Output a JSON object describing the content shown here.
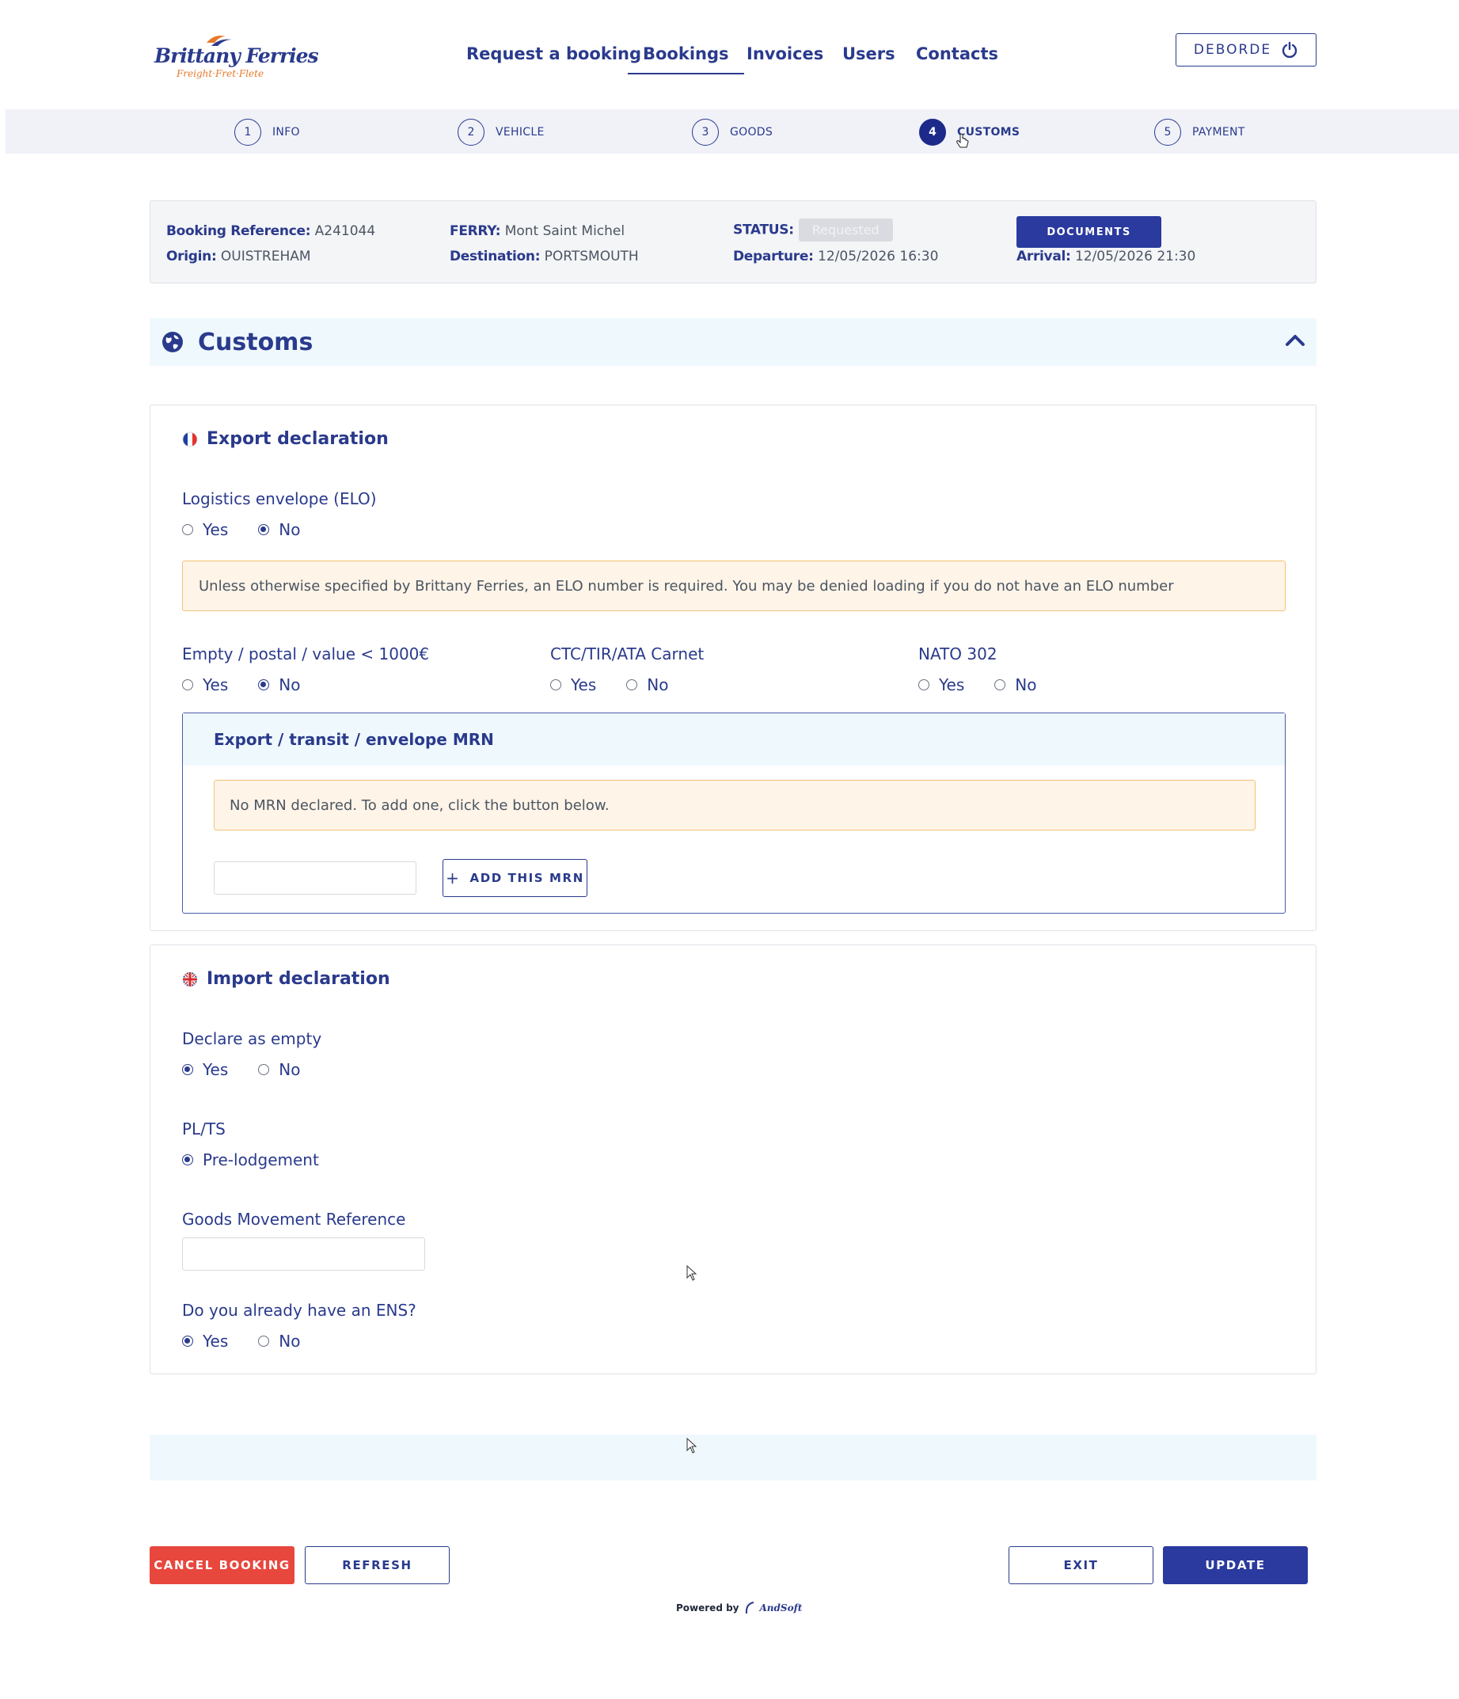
{
  "header": {
    "logo_main": "Brittany Ferries",
    "logo_sub": "Freight·Fret·Flete",
    "nav": [
      {
        "label": "Request a booking"
      },
      {
        "label": "Bookings"
      },
      {
        "label": "Invoices"
      },
      {
        "label": "Users"
      },
      {
        "label": "Contacts"
      }
    ],
    "active_nav": "Bookings",
    "user_label": "DEBORDE"
  },
  "stepper": {
    "steps": [
      {
        "number": "1",
        "label": "INFO"
      },
      {
        "number": "2",
        "label": "VEHICLE"
      },
      {
        "number": "3",
        "label": "GOODS"
      },
      {
        "number": "4",
        "label": "CUSTOMS"
      },
      {
        "number": "5",
        "label": "PAYMENT"
      }
    ],
    "active_step": "4"
  },
  "booking": {
    "reference_label": "Booking Reference:",
    "reference": "A241044",
    "origin_label": "Origin:",
    "origin": "OUISTREHAM",
    "ferry_label": "FERRY:",
    "ferry": "Mont Saint Michel",
    "destination_label": "Destination:",
    "destination": "PORTSMOUTH",
    "status_label": "STATUS:",
    "status": "Requested",
    "departure_label": "Departure:",
    "departure": "12/05/2026 16:30",
    "arrival_label": "Arrival:",
    "arrival": "12/05/2026 21:30",
    "documents_label": "DOCUMENTS"
  },
  "customs": {
    "title": "Customs",
    "export": {
      "title": "Export declaration",
      "elo_label": "Logistics envelope (ELO)",
      "elo_value": "No",
      "elo_warning": "Unless otherwise specified by Brittany Ferries, an ELO number is required. You may be denied loading if you do not have an ELO number",
      "empty_label": "Empty / postal / value < 1000€",
      "empty_value": "No",
      "carnet_label": "CTC/TIR/ATA Carnet",
      "carnet_value": "",
      "nato_label": "NATO 302",
      "nato_value": "",
      "mrn_title": "Export / transit / envelope MRN",
      "mrn_warning": "No MRN declared. To add one, click the button below.",
      "mrn_input_value": "",
      "add_mrn_label": "ADD THIS MRN"
    },
    "import": {
      "title": "Import declaration",
      "empty_label": "Declare as empty",
      "empty_value": "Yes",
      "plts_label": "PL/TS",
      "plts_option": "Pre-lodgement",
      "gmr_label": "Goods Movement Reference",
      "gmr_value": "",
      "ens_label": "Do you already have an ENS?",
      "ens_value": "Yes"
    },
    "yes_label": "Yes",
    "no_label": "No"
  },
  "footer": {
    "cancel_label": "CANCEL BOOKING",
    "refresh_label": "REFRESH",
    "exit_label": "EXIT",
    "update_label": "UPDATE",
    "powered_by": "Powered by",
    "powered_brand": "AndSoft"
  },
  "colors": {
    "brand": "#2a3a8c",
    "primary_button": "#2a3a9e",
    "danger": "#e8473e",
    "warning_bg": "#fef4e7",
    "warning_border": "#f3c27a",
    "light_band": "#eff9fd",
    "logo_accent": "#e8782a"
  }
}
